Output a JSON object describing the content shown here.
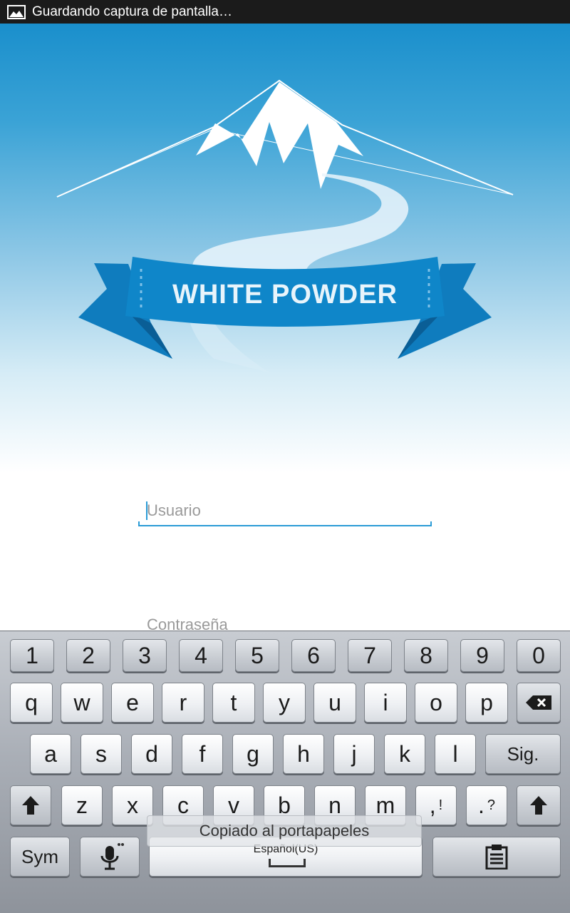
{
  "status_bar": {
    "icon": "image-icon",
    "text": "Guardando captura de pantalla…"
  },
  "app": {
    "logo_text": "WHITE POWDER",
    "colors": {
      "brand_blue": "#1a8fcc",
      "ribbon": "#0d7fc0",
      "accent": "#2a9bd6"
    }
  },
  "form": {
    "username_placeholder": "Usuario",
    "password_placeholder": "Contraseña"
  },
  "keyboard": {
    "row1": [
      "1",
      "2",
      "3",
      "4",
      "5",
      "6",
      "7",
      "8",
      "9",
      "0"
    ],
    "row2": [
      "q",
      "w",
      "e",
      "r",
      "t",
      "y",
      "u",
      "i",
      "o",
      "p"
    ],
    "row3": [
      "a",
      "s",
      "d",
      "f",
      "g",
      "h",
      "j",
      "k",
      "l"
    ],
    "next_label": "Sig.",
    "row4": [
      "z",
      "x",
      "c",
      "v",
      "b",
      "n",
      "m"
    ],
    "comma_label": ",",
    "comma_alt": "!",
    "period_label": ".",
    "period_alt": "?",
    "sym_label": "Sym",
    "space_language": "Español(US)",
    "icons": {
      "backspace": "backspace-icon",
      "shift": "shift-icon",
      "mic": "microphone-icon",
      "clipboard": "clipboard-icon"
    }
  },
  "toast": {
    "text": "Copiado al portapapeles"
  }
}
